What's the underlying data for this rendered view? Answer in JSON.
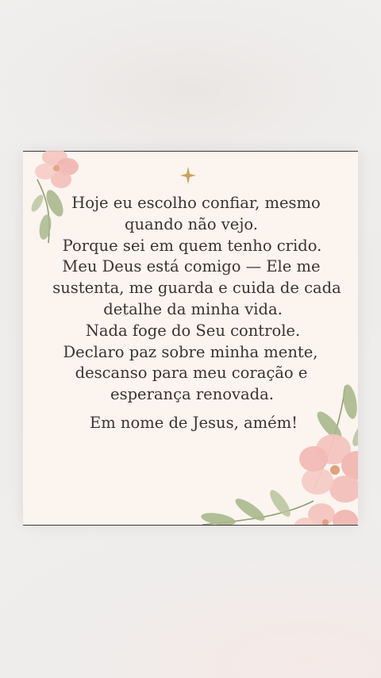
{
  "prayer": {
    "lines": [
      "Hoje eu escolho confiar, mesmo",
      "quando não vejo.",
      "Porque sei em quem tenho crido.",
      "Meu Deus está comigo — Ele me",
      "sustenta, me guarda e cuida de cada",
      "detalhe da minha vida.",
      "Nada foge do Seu controle.",
      "Declaro paz sobre minha mente,",
      "descanso para meu coração e",
      "esperança renovada.",
      "Em nome de Jesus, amém!"
    ]
  },
  "decorations": {
    "sparkle_icon": "four-point-star-icon",
    "corner_flowers": "pink-watercolor-flower-icon",
    "colors": {
      "card_background": "#fbf4ef",
      "text": "#3a3431",
      "sparkle": "#c9a15c",
      "petal": "#f0b6b0",
      "leaf": "#a9b88c"
    }
  }
}
